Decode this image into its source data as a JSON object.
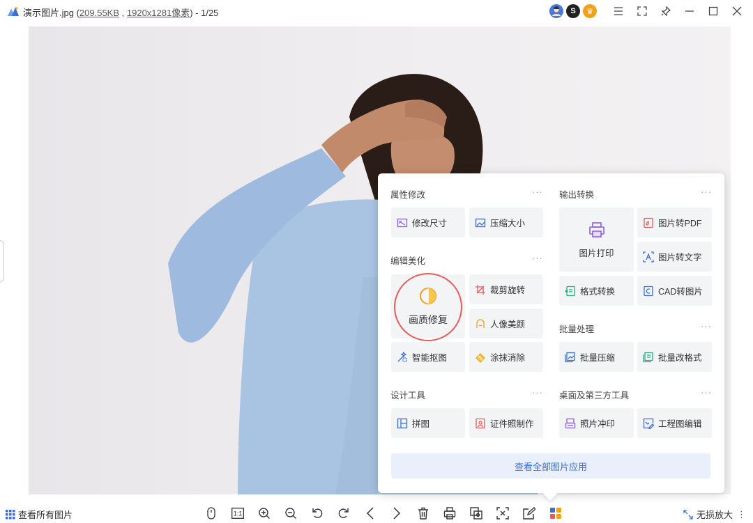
{
  "title": {
    "filename": "演示图片.jpg",
    "open_paren": " (",
    "size": "209.55KB",
    "comma": " , ",
    "dims": "1920x1281像素",
    "rest": ") - 1/25"
  },
  "colors": {
    "accent": "#3a6fd8",
    "highlight_ring": "#e55b5b",
    "tile_bg": "#f3f4f6",
    "view_all_bg": "#e9f0fc"
  },
  "badges": [
    {
      "name": "avatar-badge",
      "glyph": "",
      "color": "#4a7ad9"
    },
    {
      "name": "s-badge",
      "glyph": "S",
      "color": "#222222"
    },
    {
      "name": "crown-badge",
      "glyph": "♛",
      "color": "#f0a21a"
    }
  ],
  "panel": {
    "sec_attr": "属性修改",
    "sec_output": "输出转换",
    "sec_edit": "编辑美化",
    "sec_batch": "批量处理",
    "sec_design": "设计工具",
    "sec_desktop": "桌面及第三方工具",
    "more": "···",
    "tiles": {
      "resize": "修改尺寸",
      "compress": "压缩大小",
      "print": "图片打印",
      "to_pdf": "图片转PDF",
      "to_text": "图片转文字",
      "enhance": "画质修复",
      "crop_rotate": "裁剪旋转",
      "beauty": "人像美颜",
      "format": "格式转换",
      "cad": "CAD转图片",
      "cutout": "智能抠图",
      "erase": "涂抹消除",
      "batch_compress": "批量压缩",
      "batch_format": "批量改格式",
      "collage": "拼图",
      "id_photo": "证件照制作",
      "photo_print": "照片冲印",
      "eng_edit": "工程图编辑"
    },
    "view_all": "查看全部图片应用"
  },
  "bottom": {
    "all_pictures": "查看所有图片",
    "lossless": "无损放大",
    "one_to_one": "1:1"
  }
}
